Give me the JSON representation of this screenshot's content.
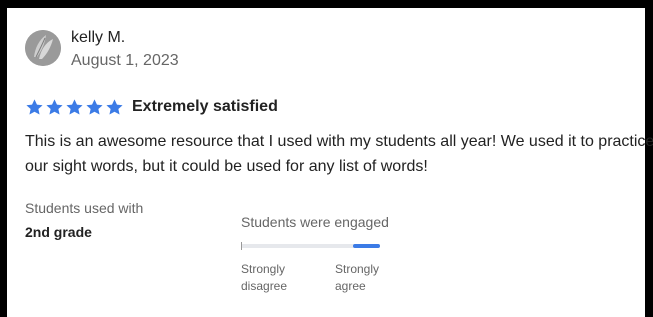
{
  "review": {
    "reviewer_name": "kelly M.",
    "date": "August 1, 2023",
    "avatar_icon": "leaf-avatar-icon",
    "rating": {
      "stars": 5,
      "max_stars": 5,
      "star_color": "#3b7be6",
      "label": "Extremely satisfied"
    },
    "text": "This is an awesome resource that I used with my students all year! We used it to practice our sight words, but it could be used for any list of words!",
    "students_used_with": {
      "label": "Students used with",
      "value": "2nd grade"
    },
    "engagement": {
      "label": "Students were engaged",
      "level": 1.0,
      "min_label_line1": "Strongly",
      "min_label_line2": "disagree",
      "max_label_line1": "Strongly",
      "max_label_line2": "agree",
      "accent_color": "#3b7be6"
    }
  }
}
